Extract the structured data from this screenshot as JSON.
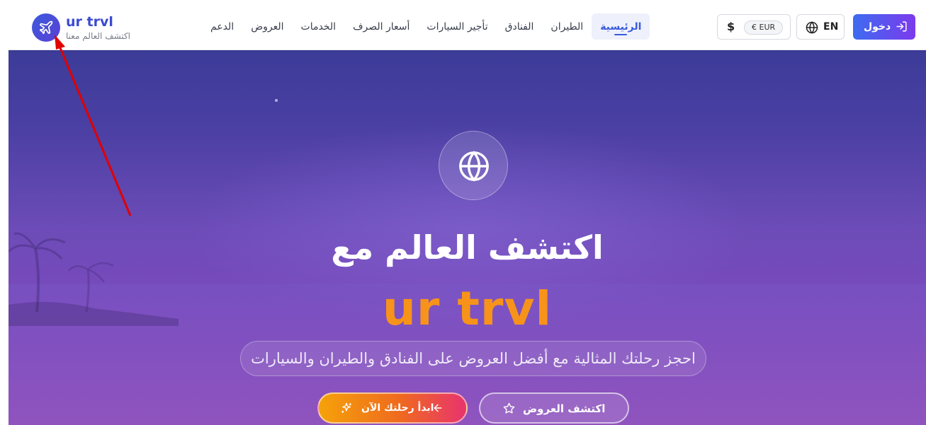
{
  "brand": {
    "name": "ur trvl",
    "tagline": "اكتشف العالم معنا",
    "icon": "airplane-icon"
  },
  "nav": {
    "items": [
      {
        "label": "الرئيسية",
        "active": true
      },
      {
        "label": "الطيران",
        "active": false
      },
      {
        "label": "الفنادق",
        "active": false
      },
      {
        "label": "تأجير السيارات",
        "active": false
      },
      {
        "label": "أسعار الصرف",
        "active": false
      },
      {
        "label": "الخدمات",
        "active": false
      },
      {
        "label": "العروض",
        "active": false
      },
      {
        "label": "الدعم",
        "active": false
      }
    ]
  },
  "currency": {
    "symbol": "$",
    "selected": "€ EUR",
    "icon": "dollar-icon"
  },
  "language": {
    "label": "EN",
    "icon": "globe-icon"
  },
  "login": {
    "label": "دخول",
    "icon": "sign-in-icon"
  },
  "hero": {
    "icon": "globe-icon",
    "title": "اكتشف العالم مع",
    "brand": "ur trvl",
    "subtitle": "احجز رحلتك المثالية مع أفضل العروض على الفنادق والطيران والسيارات",
    "primary_cta": "ابدأ رحلتك الآن",
    "primary_cta_icons": [
      "sparkle-icon",
      "arrow-left-icon"
    ],
    "secondary_cta": "اكتشف العروض",
    "secondary_cta_icon": "star-icon"
  },
  "colors": {
    "brand_blue": "#3b4bd0",
    "accent_orange": "#f7931a",
    "login_gradient": [
      "#3d6cf0",
      "#7c3aed"
    ],
    "cta_gradient": [
      "#f5a209",
      "#ef6a1f",
      "#e8336e"
    ],
    "annotation_red": "#e00000"
  }
}
